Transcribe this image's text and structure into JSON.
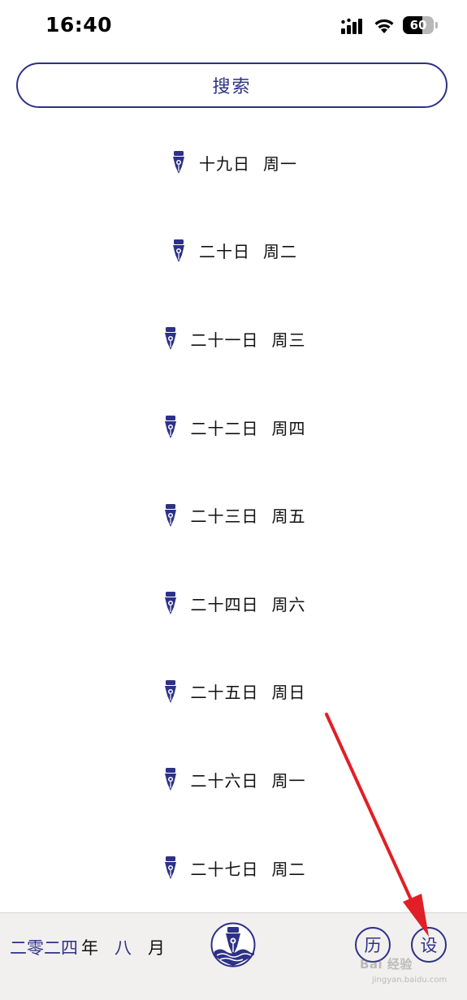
{
  "status_bar": {
    "time": "16:40",
    "battery": "60"
  },
  "search": {
    "label": "搜索"
  },
  "days": [
    {
      "date": "十九日",
      "weekday": "周一"
    },
    {
      "date": "二十日",
      "weekday": "周二"
    },
    {
      "date": "二十一日",
      "weekday": "周三"
    },
    {
      "date": "二十二日",
      "weekday": "周四"
    },
    {
      "date": "二十三日",
      "weekday": "周五"
    },
    {
      "date": "二十四日",
      "weekday": "周六"
    },
    {
      "date": "二十五日",
      "weekday": "周日"
    },
    {
      "date": "二十六日",
      "weekday": "周一"
    },
    {
      "date": "二十七日",
      "weekday": "周二"
    }
  ],
  "bottom_bar": {
    "year_value": "二零二四",
    "year_unit": "年",
    "month_value": "八",
    "month_unit": "月",
    "history_label": "历",
    "settings_label": "设",
    "watermark": "Bai 经验",
    "watermark_sub": "jingyan.baidu.com"
  },
  "colors": {
    "accent": "#2d3187",
    "annotation": "#e01f26",
    "bottom_bar_bg": "#f2f0ee"
  },
  "icons": {
    "list_item": "fountain-pen-nib-icon",
    "logo": "fountain-pen-wave-logo-icon"
  }
}
